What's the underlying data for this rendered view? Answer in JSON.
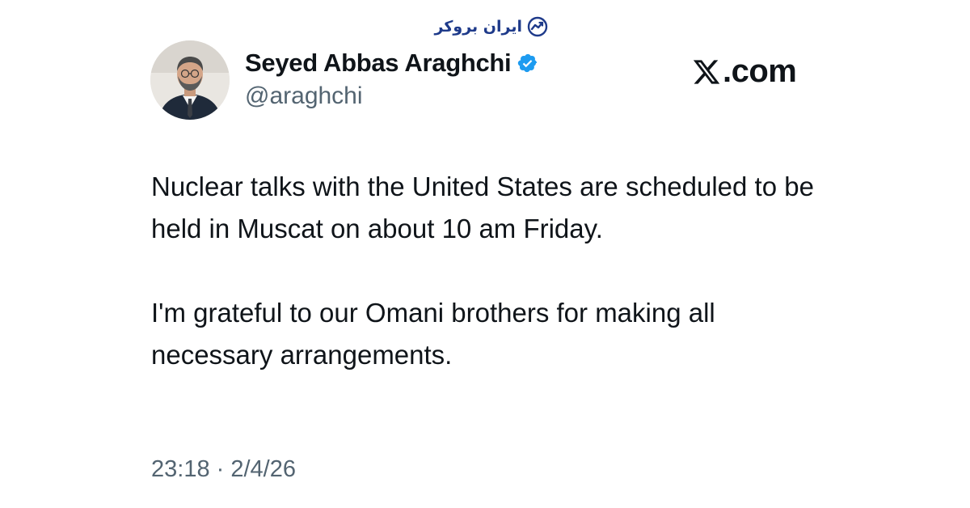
{
  "watermark": {
    "text": "ایران بروکر",
    "icon": "growth-chart-icon",
    "color": "#1e3a8a"
  },
  "author": {
    "display_name": "Seyed Abbas Araghchi",
    "handle": "@araghchi",
    "avatar_icon": "profile-photo",
    "verified_icon": "verified-badge-icon",
    "verified_color": "#1d9bf0"
  },
  "brand": {
    "icon": "x-logo-icon",
    "text": ".com"
  },
  "tweet": {
    "paragraphs": [
      "Nuclear talks with the United States are scheduled to be held in Muscat on about 10 am Friday.",
      "I'm grateful to our Omani brothers for making all necessary arrangements."
    ],
    "timestamp": "23:18 · 2/4/26"
  }
}
